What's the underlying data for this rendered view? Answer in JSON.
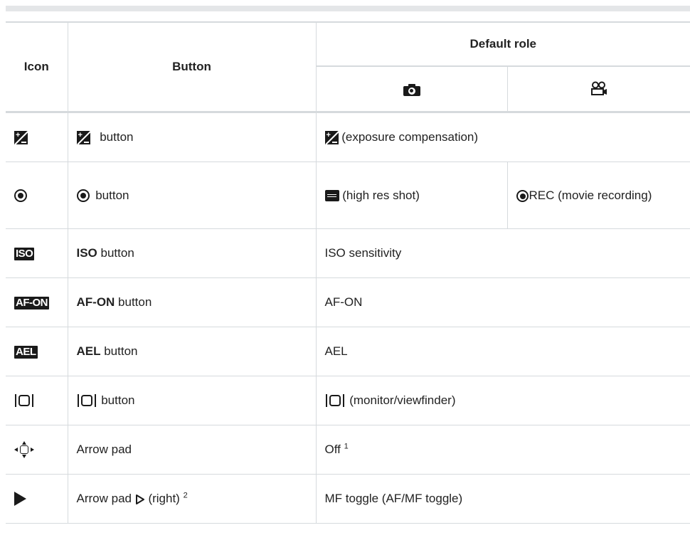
{
  "header": {
    "icon_col": "Icon",
    "button_col": "Button",
    "default_role": "Default role",
    "photo_mode_icon": "camera-icon",
    "movie_mode_icon": "movie-icon"
  },
  "rows": [
    {
      "icon": "exposure-compensation-icon",
      "button_text": " button",
      "role": " (exposure compensation)"
    },
    {
      "icon": "target-record-icon",
      "button_text": " button",
      "role_photo": " (high res shot)",
      "role_movie": "REC (movie recording)"
    },
    {
      "icon": "iso-icon",
      "icon_text": "ISO",
      "button_bold": "ISO",
      "button_text": " button",
      "role": "ISO sensitivity"
    },
    {
      "icon": "af-on-icon",
      "icon_text": "AF-ON",
      "button_bold": "AF-ON",
      "button_text": " button",
      "role": "AF-ON"
    },
    {
      "icon": "ael-icon",
      "icon_text": "AEL",
      "button_bold": "AEL",
      "button_text": " button",
      "role": "AEL"
    },
    {
      "icon": "monitor-viewfinder-icon",
      "button_text": " button",
      "role": " (monitor/viewfinder)"
    },
    {
      "icon": "arrow-pad-icon",
      "button_text": "Arrow pad",
      "role": "Off",
      "role_note": "1"
    },
    {
      "icon": "play-icon",
      "button_text": "Arrow pad",
      "button_suffix": " (right)",
      "button_note": "2",
      "role": "MF toggle (AF/MF toggle)"
    }
  ]
}
